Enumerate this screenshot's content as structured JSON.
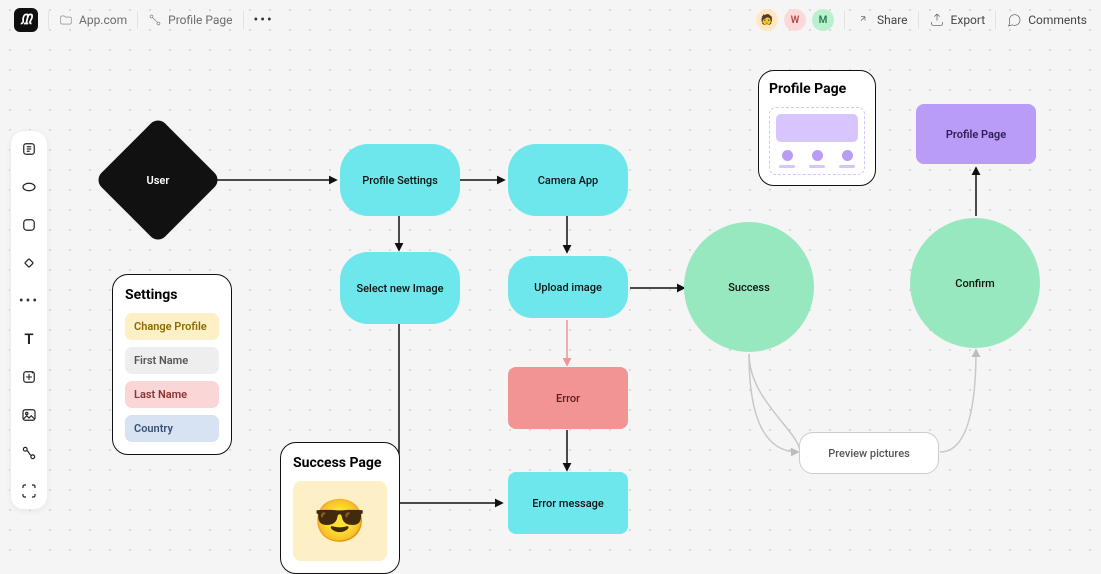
{
  "header": {
    "app_name": "App.com",
    "page_name": "Profile Page",
    "share_label": "Share",
    "export_label": "Export",
    "comments_label": "Comments",
    "avatars": {
      "w": "W",
      "m": "M"
    }
  },
  "toolbar": {
    "tools": [
      "rectangle",
      "ellipse",
      "rounded-square",
      "diamond",
      "more",
      "text",
      "sparkle",
      "image",
      "connector",
      "screenshot"
    ]
  },
  "nodes": {
    "user": "User",
    "profile_settings": "Profile Settings",
    "camera_app": "Camera App",
    "select_new_image": "Select new Image",
    "upload_image": "Upload image",
    "error": "Error",
    "error_message": "Error message",
    "success": "Success",
    "confirm": "Confirm",
    "preview_pictures": "Preview pictures",
    "profile_page_tile": "Profile Page"
  },
  "cards": {
    "settings": {
      "title": "Settings",
      "items": [
        {
          "label": "Change Profile",
          "style": "yellow"
        },
        {
          "label": "First Name",
          "style": "gray"
        },
        {
          "label": "Last Name",
          "style": "red"
        },
        {
          "label": "Country",
          "style": "blue"
        }
      ]
    },
    "profile_page": {
      "title": "Profile Page"
    },
    "success_page": {
      "title": "Success Page",
      "emoji": "😎"
    }
  },
  "colors": {
    "cyan": "#6de7eb",
    "green": "#97e8be",
    "purple": "#b89cf5",
    "red": "#f29494",
    "black": "#111111"
  }
}
